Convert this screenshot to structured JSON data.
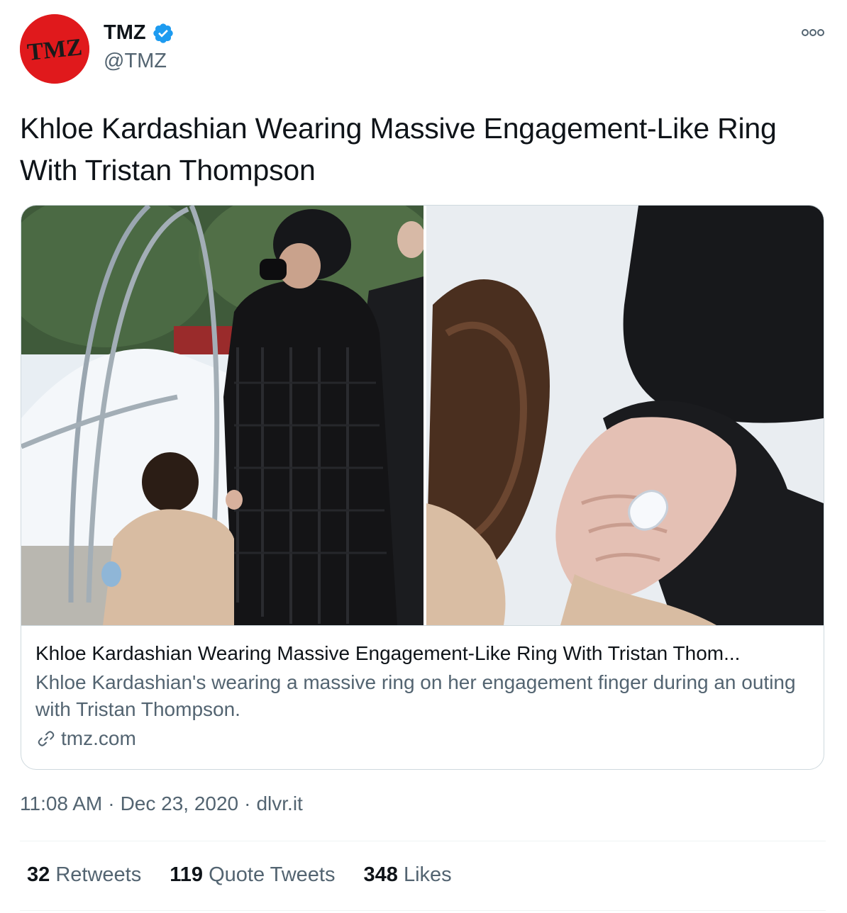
{
  "author": {
    "name": "TMZ",
    "handle": "@TMZ",
    "avatar_text": "TMZ",
    "avatar_color": "#e0191c",
    "verified_color": "#1d9bf0"
  },
  "tweet": {
    "text": "Khloe Kardashian Wearing Massive Engagement-Like Ring With Tristan Thompson"
  },
  "card": {
    "title": "Khloe Kardashian Wearing Massive Engagement-Like Ring With Tristan Thom...",
    "description": "Khloe Kardashian's wearing a massive ring on her engagement finger during an outing with Tristan Thompson.",
    "domain": "tmz.com",
    "image_alt": "Khloe Kardashian holding hands with a child; close-up of a diamond ring",
    "domain_icon": "link-icon"
  },
  "meta": {
    "time": "11:08 AM",
    "date": "Dec 23, 2020",
    "source": "dlvr.it",
    "separator": "·"
  },
  "stats": {
    "retweets_count": "32",
    "retweets_label": "Retweets",
    "quotes_count": "119",
    "quotes_label": "Quote Tweets",
    "likes_count": "348",
    "likes_label": "Likes"
  },
  "colors": {
    "text_primary": "#0f1419",
    "text_secondary": "#536471",
    "border": "#cfd9de"
  }
}
